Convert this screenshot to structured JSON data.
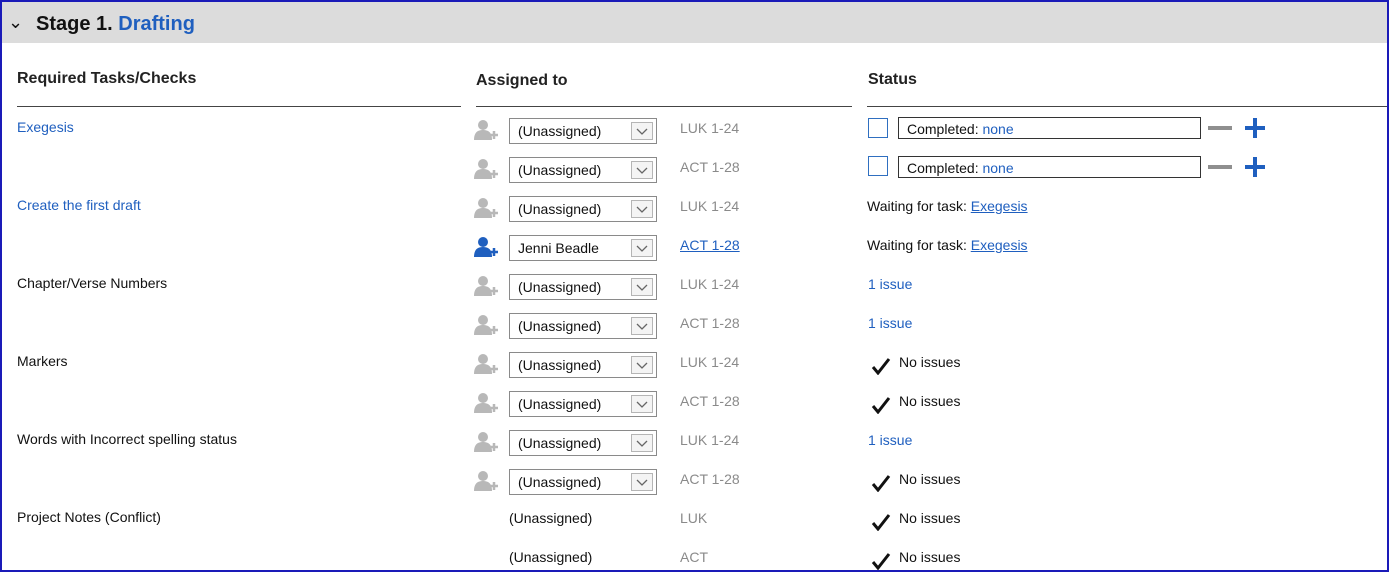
{
  "stage": {
    "label": "Stage 1.",
    "name": "Drafting"
  },
  "columns": {
    "tasks": "Required Tasks/Checks",
    "assigned": "Assigned to",
    "status": "Status"
  },
  "tasks": [
    {
      "name": "Exegesis",
      "is_link": true
    },
    {
      "name": "Create the first draft",
      "is_link": true
    },
    {
      "name": "Chapter/Verse Numbers",
      "is_link": false
    },
    {
      "name": "Markers",
      "is_link": false
    },
    {
      "name": "Words with Incorrect spelling status",
      "is_link": false
    },
    {
      "name": "Project Notes (Conflict)",
      "is_link": false
    }
  ],
  "rows": [
    {
      "assignee": "(Unassigned)",
      "book": "LUK 1-24",
      "status_kind": "completed",
      "completed_label": "Completed:",
      "completed_value": "none"
    },
    {
      "assignee": "(Unassigned)",
      "book": "ACT 1-28",
      "status_kind": "completed",
      "completed_label": "Completed:",
      "completed_value": "none"
    },
    {
      "assignee": "(Unassigned)",
      "book": "LUK 1-24",
      "status_kind": "waiting",
      "waiting_prefix": "Waiting for task:",
      "waiting_task": "Exegesis"
    },
    {
      "assignee": "Jenni Beadle",
      "book": "ACT 1-28",
      "status_kind": "waiting",
      "waiting_prefix": "Waiting for task:",
      "waiting_task": "Exegesis"
    },
    {
      "assignee": "(Unassigned)",
      "book": "LUK 1-24",
      "status_kind": "issue",
      "status": "1 issue"
    },
    {
      "assignee": "(Unassigned)",
      "book": "ACT 1-28",
      "status_kind": "issue",
      "status": "1 issue"
    },
    {
      "assignee": "(Unassigned)",
      "book": "LUK 1-24",
      "status_kind": "ok",
      "status": "No issues"
    },
    {
      "assignee": "(Unassigned)",
      "book": "ACT 1-28",
      "status_kind": "ok",
      "status": "No issues"
    },
    {
      "assignee": "(Unassigned)",
      "book": "LUK 1-24",
      "status_kind": "issue",
      "status": "1 issue"
    },
    {
      "assignee": "(Unassigned)",
      "book": "ACT 1-28",
      "status_kind": "ok",
      "status": "No issues"
    },
    {
      "assignee": "(Unassigned)",
      "book": "LUK",
      "status_kind": "ok",
      "status": "No issues"
    },
    {
      "assignee": "(Unassigned)",
      "book": "ACT",
      "status_kind": "ok",
      "status": "No issues"
    }
  ],
  "colors": {
    "accent": "#1f5fbf",
    "header_bg": "#dcdcdc",
    "muted": "#8a8a8a",
    "border": "#1a1ab8"
  }
}
